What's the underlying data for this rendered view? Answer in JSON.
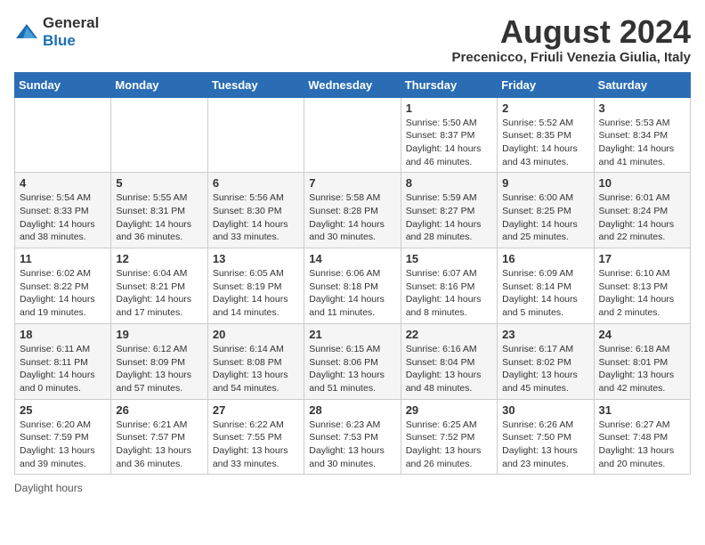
{
  "logo": {
    "general": "General",
    "blue": "Blue"
  },
  "title": "August 2024",
  "subtitle": "Precenicco, Friuli Venezia Giulia, Italy",
  "weekdays": [
    "Sunday",
    "Monday",
    "Tuesday",
    "Wednesday",
    "Thursday",
    "Friday",
    "Saturday"
  ],
  "weeks": [
    [
      {
        "day": "",
        "info": ""
      },
      {
        "day": "",
        "info": ""
      },
      {
        "day": "",
        "info": ""
      },
      {
        "day": "",
        "info": ""
      },
      {
        "day": "1",
        "info": "Sunrise: 5:50 AM\nSunset: 8:37 PM\nDaylight: 14 hours and 46 minutes."
      },
      {
        "day": "2",
        "info": "Sunrise: 5:52 AM\nSunset: 8:35 PM\nDaylight: 14 hours and 43 minutes."
      },
      {
        "day": "3",
        "info": "Sunrise: 5:53 AM\nSunset: 8:34 PM\nDaylight: 14 hours and 41 minutes."
      }
    ],
    [
      {
        "day": "4",
        "info": "Sunrise: 5:54 AM\nSunset: 8:33 PM\nDaylight: 14 hours and 38 minutes."
      },
      {
        "day": "5",
        "info": "Sunrise: 5:55 AM\nSunset: 8:31 PM\nDaylight: 14 hours and 36 minutes."
      },
      {
        "day": "6",
        "info": "Sunrise: 5:56 AM\nSunset: 8:30 PM\nDaylight: 14 hours and 33 minutes."
      },
      {
        "day": "7",
        "info": "Sunrise: 5:58 AM\nSunset: 8:28 PM\nDaylight: 14 hours and 30 minutes."
      },
      {
        "day": "8",
        "info": "Sunrise: 5:59 AM\nSunset: 8:27 PM\nDaylight: 14 hours and 28 minutes."
      },
      {
        "day": "9",
        "info": "Sunrise: 6:00 AM\nSunset: 8:25 PM\nDaylight: 14 hours and 25 minutes."
      },
      {
        "day": "10",
        "info": "Sunrise: 6:01 AM\nSunset: 8:24 PM\nDaylight: 14 hours and 22 minutes."
      }
    ],
    [
      {
        "day": "11",
        "info": "Sunrise: 6:02 AM\nSunset: 8:22 PM\nDaylight: 14 hours and 19 minutes."
      },
      {
        "day": "12",
        "info": "Sunrise: 6:04 AM\nSunset: 8:21 PM\nDaylight: 14 hours and 17 minutes."
      },
      {
        "day": "13",
        "info": "Sunrise: 6:05 AM\nSunset: 8:19 PM\nDaylight: 14 hours and 14 minutes."
      },
      {
        "day": "14",
        "info": "Sunrise: 6:06 AM\nSunset: 8:18 PM\nDaylight: 14 hours and 11 minutes."
      },
      {
        "day": "15",
        "info": "Sunrise: 6:07 AM\nSunset: 8:16 PM\nDaylight: 14 hours and 8 minutes."
      },
      {
        "day": "16",
        "info": "Sunrise: 6:09 AM\nSunset: 8:14 PM\nDaylight: 14 hours and 5 minutes."
      },
      {
        "day": "17",
        "info": "Sunrise: 6:10 AM\nSunset: 8:13 PM\nDaylight: 14 hours and 2 minutes."
      }
    ],
    [
      {
        "day": "18",
        "info": "Sunrise: 6:11 AM\nSunset: 8:11 PM\nDaylight: 14 hours and 0 minutes."
      },
      {
        "day": "19",
        "info": "Sunrise: 6:12 AM\nSunset: 8:09 PM\nDaylight: 13 hours and 57 minutes."
      },
      {
        "day": "20",
        "info": "Sunrise: 6:14 AM\nSunset: 8:08 PM\nDaylight: 13 hours and 54 minutes."
      },
      {
        "day": "21",
        "info": "Sunrise: 6:15 AM\nSunset: 8:06 PM\nDaylight: 13 hours and 51 minutes."
      },
      {
        "day": "22",
        "info": "Sunrise: 6:16 AM\nSunset: 8:04 PM\nDaylight: 13 hours and 48 minutes."
      },
      {
        "day": "23",
        "info": "Sunrise: 6:17 AM\nSunset: 8:02 PM\nDaylight: 13 hours and 45 minutes."
      },
      {
        "day": "24",
        "info": "Sunrise: 6:18 AM\nSunset: 8:01 PM\nDaylight: 13 hours and 42 minutes."
      }
    ],
    [
      {
        "day": "25",
        "info": "Sunrise: 6:20 AM\nSunset: 7:59 PM\nDaylight: 13 hours and 39 minutes."
      },
      {
        "day": "26",
        "info": "Sunrise: 6:21 AM\nSunset: 7:57 PM\nDaylight: 13 hours and 36 minutes."
      },
      {
        "day": "27",
        "info": "Sunrise: 6:22 AM\nSunset: 7:55 PM\nDaylight: 13 hours and 33 minutes."
      },
      {
        "day": "28",
        "info": "Sunrise: 6:23 AM\nSunset: 7:53 PM\nDaylight: 13 hours and 30 minutes."
      },
      {
        "day": "29",
        "info": "Sunrise: 6:25 AM\nSunset: 7:52 PM\nDaylight: 13 hours and 26 minutes."
      },
      {
        "day": "30",
        "info": "Sunrise: 6:26 AM\nSunset: 7:50 PM\nDaylight: 13 hours and 23 minutes."
      },
      {
        "day": "31",
        "info": "Sunrise: 6:27 AM\nSunset: 7:48 PM\nDaylight: 13 hours and 20 minutes."
      }
    ]
  ],
  "footer": {
    "daylight_label": "Daylight hours"
  }
}
